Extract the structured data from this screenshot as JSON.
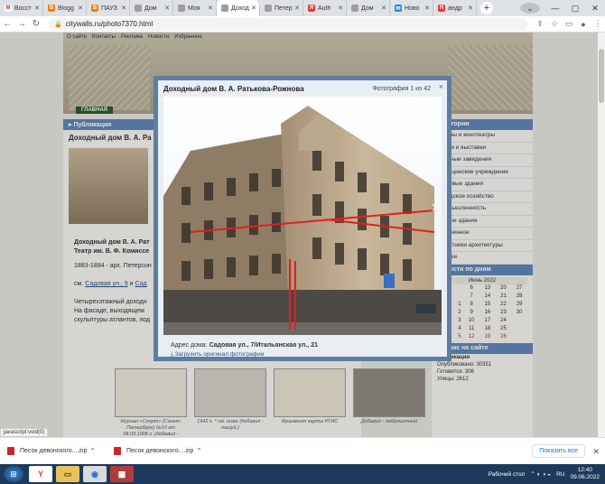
{
  "browser": {
    "tabs": [
      {
        "label": "Восст",
        "fav_color": "#ffffff",
        "fav_text": "M",
        "fav_text_color": "#d93025"
      },
      {
        "label": "Blogg",
        "fav_color": "#f57c00",
        "fav_text": "B",
        "fav_text_color": "#ffffff"
      },
      {
        "label": "ПАУЗ",
        "fav_color": "#f57c00",
        "fav_text": "B",
        "fav_text_color": "#ffffff"
      },
      {
        "label": "Дом",
        "fav_color": "#9e9e9e",
        "fav_text": "",
        "fav_text_color": "#ffffff"
      },
      {
        "label": "Моя",
        "fav_color": "#9e9e9e",
        "fav_text": "",
        "fav_text_color": "#ffffff"
      },
      {
        "label": "Доход",
        "fav_color": "#9e9e9e",
        "fav_text": "",
        "fav_text_color": "#ffffff",
        "active": true
      },
      {
        "label": "Петер",
        "fav_color": "#9e9e9e",
        "fav_text": "",
        "fav_text_color": "#ffffff"
      },
      {
        "label": "Auth",
        "fav_color": "#e53935",
        "fav_text": "Я",
        "fav_text_color": "#ffffff"
      },
      {
        "label": "Дом",
        "fav_color": "#9e9e9e",
        "fav_text": "",
        "fav_text_color": "#ffffff"
      },
      {
        "label": "Ново",
        "fav_color": "#1e88e5",
        "fav_text": "✉",
        "fav_text_color": "#ffffff"
      },
      {
        "label": "андр",
        "fav_color": "#e53935",
        "fav_text": "Я",
        "fav_text_color": "#ffffff"
      }
    ],
    "url": "citywalls.ru/photo7370.html",
    "status_text": "javascript:void(0)"
  },
  "site": {
    "topnav": [
      "О сайте",
      "Контакты",
      "Реклама",
      "Новости",
      "Избранное"
    ],
    "home_label": "ГЛАВНАЯ",
    "publication_label": "Публикация",
    "page_heading": "Доходный дом В. А. Ра",
    "left_text": {
      "line1": "Доходный дом В. А. Рат",
      "line2": "Театр им. В. Ф. Комиссе",
      "line3": "1883-1884 - арх. Петерсон",
      "see_prefix": "см.",
      "see_link1": "Садовая ул., 9",
      "see_and": "и",
      "see_link2": "Сад",
      "desc1": "Четырехэтажный доходн",
      "desc2": "На фасаде, выходящем",
      "desc3": "скульптуры атлантов, под"
    },
    "thumbs": [
      {
        "caption": "Журнал «Спорт» (Санкт-Петербург) №10 от 08.03.1908 г. (добавил - lanaich)"
      },
      {
        "caption": "1942 г. * см. ниже (добавил - пашуй.)"
      },
      {
        "caption": "Фрагмент карты РГИС"
      },
      {
        "caption": "Добавил - любопытный"
      }
    ],
    "right": {
      "categories_title": "Категории",
      "items": [
        "Театры и кинотеатры",
        "Музеи и выставки",
        "Учебные заведения",
        "Медицинские учреждения",
        "Торговые здания",
        "Городское хозяйство",
        "Промышленность",
        "Жилые здания",
        "Утраченное",
        "Памятники архитектуры",
        "Прочее"
      ],
      "news_title": "Новости по дням",
      "month": "Июнь 2022",
      "day_labels": [
        "Ср",
        "Чт",
        "Пт",
        "Сб",
        "Вс"
      ],
      "cal_rows": [
        [
          "",
          "6",
          "13",
          "20",
          "27"
        ],
        [
          "",
          "7",
          "14",
          "21",
          "28"
        ],
        [
          "1",
          "8",
          "15",
          "22",
          "29"
        ],
        [
          "2",
          "9",
          "16",
          "23",
          "30"
        ],
        [
          "3",
          "10",
          "17",
          "24",
          ""
        ],
        [
          "4",
          "11",
          "18",
          "25",
          ""
        ],
        [
          "5",
          "12",
          "19",
          "26",
          ""
        ]
      ],
      "site_title": "Сейчас на сайте",
      "pub_label": "Публикации",
      "stats": [
        "Опубликовано: 30351",
        "Готовится: 306",
        "Улицы: 2612"
      ]
    }
  },
  "modal": {
    "title": "Доходный дом В. А. Ратькова-Рожнова",
    "counter": "Фотография 1 из 42",
    "close": "×",
    "address_prefix": "Адрес дома:",
    "address": "Садовая ул., 7/Итальянская ул., 21",
    "download": "Загрузить оригинал фотографии"
  },
  "downloads": {
    "items": [
      "Песок девонского....zip",
      "Песок девонского....zip"
    ],
    "show_all": "Показать все"
  },
  "taskbar": {
    "desktop_label": "Рабочий стол",
    "lang": "RU",
    "time": "12:40",
    "date": "09.06.2022"
  }
}
